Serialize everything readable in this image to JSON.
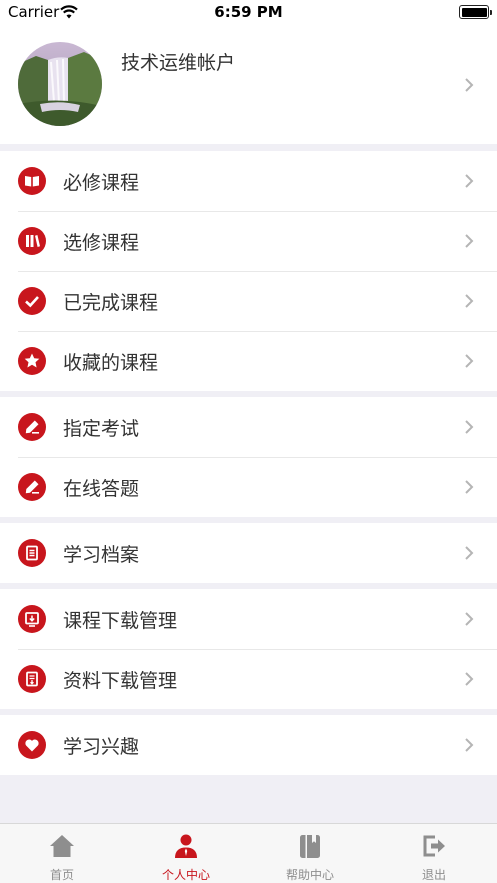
{
  "status_bar": {
    "carrier": "Carrier",
    "time": "6:59 PM"
  },
  "profile": {
    "account_name": "技术运维帐户"
  },
  "groups": [
    {
      "items": [
        {
          "label": "必修课程",
          "icon": "book-icon"
        },
        {
          "label": "选修课程",
          "icon": "library-icon"
        },
        {
          "label": "已完成课程",
          "icon": "check-icon"
        },
        {
          "label": "收藏的课程",
          "icon": "star-icon"
        }
      ]
    },
    {
      "items": [
        {
          "label": "指定考试",
          "icon": "pencil-icon"
        },
        {
          "label": "在线答题",
          "icon": "pencil-icon"
        }
      ]
    },
    {
      "items": [
        {
          "label": "学习档案",
          "icon": "document-icon"
        }
      ]
    },
    {
      "items": [
        {
          "label": "课程下载管理",
          "icon": "download-screen-icon"
        },
        {
          "label": "资料下载管理",
          "icon": "download-document-icon"
        }
      ]
    },
    {
      "items": [
        {
          "label": "学习兴趣",
          "icon": "heart-icon"
        }
      ]
    }
  ],
  "tab_bar": {
    "tabs": [
      {
        "label": "首页",
        "icon": "home-icon"
      },
      {
        "label": "个人中心",
        "icon": "person-icon",
        "active": true
      },
      {
        "label": "帮助中心",
        "icon": "help-book-icon"
      },
      {
        "label": "退出",
        "icon": "logout-icon"
      }
    ]
  },
  "colors": {
    "accent": "#c8161d",
    "background": "#f0eff5",
    "inactive": "#8e8e8e"
  }
}
